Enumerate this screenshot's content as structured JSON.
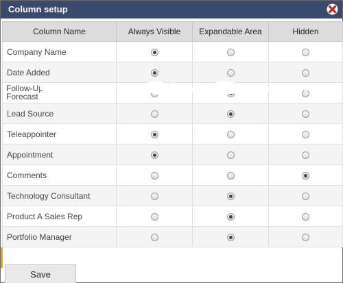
{
  "dialog": {
    "title": "Column setup",
    "close_icon": "close-icon",
    "accent_color": "#3a4a6d",
    "close_color": "#d22020"
  },
  "table": {
    "headers": [
      "Column Name",
      "Always Visible",
      "Expandable Area",
      "Hidden"
    ],
    "rows": [
      {
        "label": "Company Name",
        "selected": "Always Visible"
      },
      {
        "label": "Date Added",
        "selected": "Always Visible"
      },
      {
        "label": "Follow-Up",
        "label2": "Forecast",
        "selected": "Expandable Area"
      },
      {
        "label": "Lead Source",
        "selected": "Expandable Area"
      },
      {
        "label": "Teleappointer",
        "selected": "Always Visible"
      },
      {
        "label": "Appointment",
        "selected": "Always Visible"
      },
      {
        "label": "Comments",
        "selected": "Hidden"
      },
      {
        "label": "Technology Consultant",
        "selected": "Expandable Area"
      },
      {
        "label": "Product A Sales Rep",
        "selected": "Expandable Area"
      },
      {
        "label": "Portfolio Manager",
        "selected": "Expandable Area"
      }
    ]
  },
  "footer": {
    "save_label": "Save"
  }
}
